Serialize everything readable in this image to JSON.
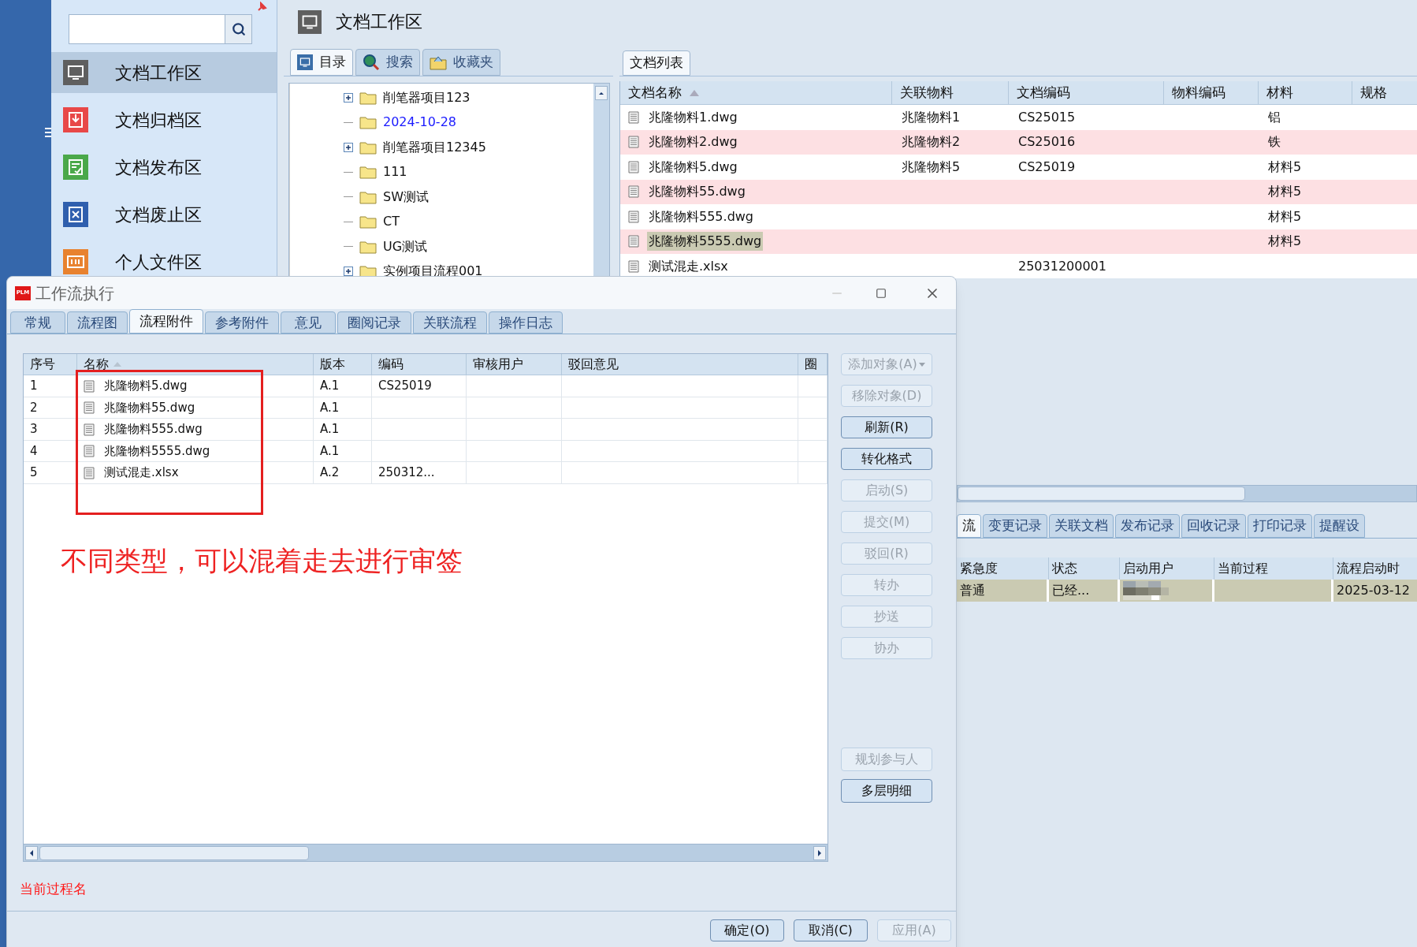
{
  "sidebar": {
    "items": [
      {
        "label": "文档工作区",
        "color": "#5f5f5f",
        "selected": true
      },
      {
        "label": "文档归档区",
        "color": "#e84848",
        "selected": false
      },
      {
        "label": "文档发布区",
        "color": "#4aa84a",
        "selected": false
      },
      {
        "label": "文档废止区",
        "color": "#2f5fae",
        "selected": false
      },
      {
        "label": "个人文件区",
        "color": "#e8822f",
        "selected": false
      }
    ]
  },
  "workspace": {
    "title": "文档工作区"
  },
  "tree_tabs": [
    {
      "label": "目录",
      "selected": true
    },
    {
      "label": "搜索",
      "selected": false
    },
    {
      "label": "收藏夹",
      "selected": false
    }
  ],
  "tree": [
    {
      "label": "削笔器项目123",
      "expandable": true,
      "highlighted": false
    },
    {
      "label": "2024-10-28",
      "expandable": false,
      "highlighted": true
    },
    {
      "label": "削笔器项目12345",
      "expandable": true,
      "highlighted": false
    },
    {
      "label": "111",
      "expandable": false,
      "highlighted": false
    },
    {
      "label": "SW测试",
      "expandable": false,
      "highlighted": false
    },
    {
      "label": "CT",
      "expandable": false,
      "highlighted": false
    },
    {
      "label": "UG测试",
      "expandable": false,
      "highlighted": false
    },
    {
      "label": "实例项目流程001",
      "expandable": true,
      "highlighted": false
    }
  ],
  "doc_list": {
    "tab": "文档列表",
    "columns": [
      "文档名称",
      "关联物料",
      "文档编码",
      "物料编码",
      "材料",
      "规格"
    ],
    "rows": [
      {
        "cells": [
          "兆隆物料1.dwg",
          "兆隆物料1",
          "CS25015",
          null,
          "铝",
          null
        ],
        "selected": false
      },
      {
        "cells": [
          "兆隆物料2.dwg",
          "兆隆物料2",
          "CS25016",
          null,
          "铁",
          null
        ],
        "selected": false
      },
      {
        "cells": [
          "兆隆物料5.dwg",
          "兆隆物料5",
          "CS25019",
          null,
          "材料5",
          null
        ],
        "selected": false
      },
      {
        "cells": [
          "兆隆物料55.dwg",
          null,
          null,
          null,
          "材料5",
          null
        ],
        "selected": false
      },
      {
        "cells": [
          "兆隆物料555.dwg",
          null,
          null,
          null,
          "材料5",
          null
        ],
        "selected": false
      },
      {
        "cells": [
          "兆隆物料5555.dwg",
          null,
          null,
          null,
          "材料5",
          null
        ],
        "selected": true
      },
      {
        "cells": [
          "测试混走.xlsx",
          null,
          "25031200001",
          null,
          null,
          null
        ],
        "selected": false
      }
    ]
  },
  "lower_tabs": [
    {
      "label": "流",
      "selected": true
    },
    {
      "label": "变更记录",
      "selected": false
    },
    {
      "label": "关联文档",
      "selected": false
    },
    {
      "label": "发布记录",
      "selected": false
    },
    {
      "label": "回收记录",
      "selected": false
    },
    {
      "label": "打印记录",
      "selected": false
    },
    {
      "label": "提醒设",
      "selected": false
    }
  ],
  "lower_grid": {
    "columns": [
      "紧急度",
      "状态",
      "启动用户",
      "当前过程",
      "流程启动时"
    ],
    "rows": [
      {
        "cells": [
          "普通",
          "已经...",
          null,
          null,
          "2025-03-12"
        ],
        "selected": true
      }
    ]
  },
  "dialog": {
    "logo": "PLM",
    "title": "工作流执行",
    "tabs": [
      {
        "label": "常规",
        "selected": false
      },
      {
        "label": "流程图",
        "selected": false
      },
      {
        "label": "流程附件",
        "selected": true
      },
      {
        "label": "参考附件",
        "selected": false
      },
      {
        "label": "意见",
        "selected": false
      },
      {
        "label": "圈阅记录",
        "selected": false
      },
      {
        "label": "关联流程",
        "selected": false
      },
      {
        "label": "操作日志",
        "selected": false
      }
    ],
    "table": {
      "columns": [
        "序号",
        "名称",
        "版本",
        "编码",
        "审核用户",
        "驳回意见",
        "圈"
      ],
      "rows": [
        {
          "cells": [
            "1",
            "兆隆物料5.dwg",
            "A.1",
            "CS25019"
          ]
        },
        {
          "cells": [
            "2",
            "兆隆物料55.dwg",
            "A.1",
            null
          ]
        },
        {
          "cells": [
            "3",
            "兆隆物料555.dwg",
            "A.1",
            null
          ]
        },
        {
          "cells": [
            "4",
            "兆隆物料5555.dwg",
            "A.1",
            null
          ]
        },
        {
          "cells": [
            "5",
            "测试混走.xlsx",
            "A.2",
            "250312..."
          ]
        }
      ]
    },
    "side_buttons": [
      {
        "label": "添加对象(A)",
        "disabled": true,
        "dropdown": true
      },
      {
        "label": "移除对象(D)",
        "disabled": true,
        "dropdown": false
      },
      {
        "label": "刷新(R)",
        "disabled": false,
        "dropdown": false
      },
      {
        "label": "转化格式",
        "disabled": false,
        "dropdown": false
      },
      {
        "label": "启动(S)",
        "disabled": true,
        "dropdown": false
      },
      {
        "label": "提交(M)",
        "disabled": true,
        "dropdown": false
      },
      {
        "label": "驳回(R)",
        "disabled": true,
        "dropdown": false
      },
      {
        "label": "转办",
        "disabled": true,
        "dropdown": false
      },
      {
        "label": "抄送",
        "disabled": true,
        "dropdown": false
      },
      {
        "label": "协办",
        "disabled": true,
        "dropdown": false
      }
    ],
    "lower_buttons": [
      {
        "label": "规划参与人",
        "disabled": true
      },
      {
        "label": "多层明细",
        "disabled": false
      }
    ],
    "annotation": "不同类型，可以混着走去进行审签",
    "status": "当前过程名",
    "footer_buttons": [
      {
        "label": "确定(O)",
        "disabled": false
      },
      {
        "label": "取消(C)",
        "disabled": false
      },
      {
        "label": "应用(A)",
        "disabled": true
      }
    ]
  }
}
